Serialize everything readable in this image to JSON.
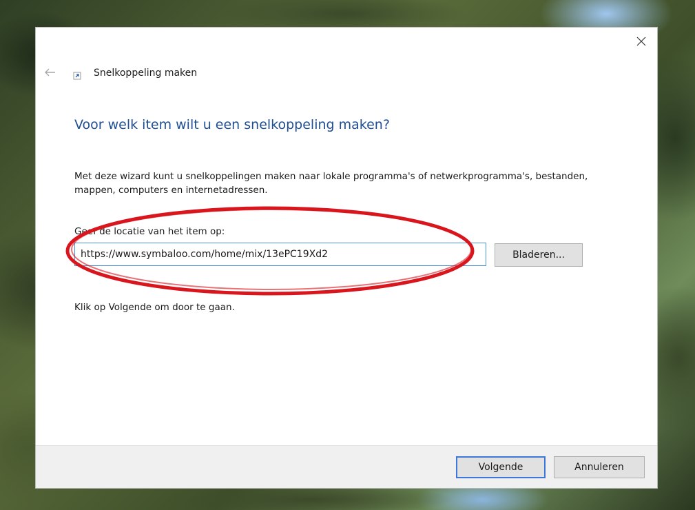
{
  "window": {
    "title": "Snelkoppeling maken",
    "close_icon": "close-icon",
    "back_icon": "back-arrow-icon",
    "title_icon": "shortcut-icon"
  },
  "content": {
    "heading": "Voor welk item wilt u een snelkoppeling maken?",
    "description": "Met deze wizard kunt u snelkoppelingen maken naar lokale programma's of netwerkprogramma's, bestanden, mappen, computers en internetadressen.",
    "field_label": "Geef de locatie van het item op:",
    "location_value": "https://www.symbaloo.com/home/mix/13ePC19Xd2",
    "browse_label": "Bladeren...",
    "hint": "Klik op Volgende om door te gaan."
  },
  "footer": {
    "next_label": "Volgende",
    "cancel_label": "Annuleren"
  },
  "colors": {
    "heading": "#1f4e93",
    "accent": "#3b78d8",
    "annotation": "#d9161d"
  }
}
